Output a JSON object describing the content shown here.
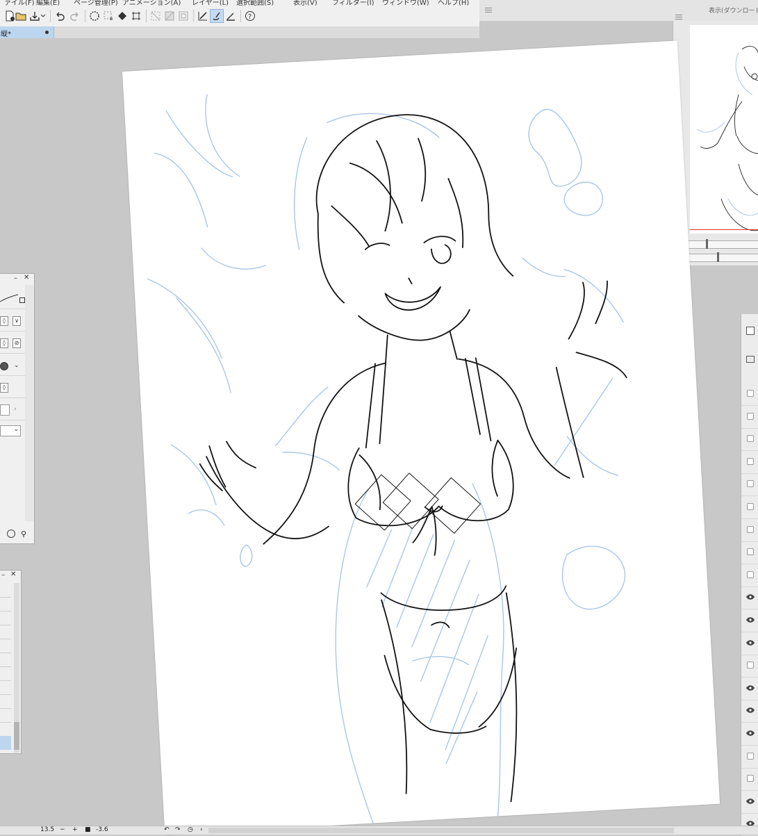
{
  "window": {
    "document_tab": "縦*"
  },
  "menu": {
    "items": [
      "ァイル(F)",
      "編集(E)",
      "ページ管理(P)",
      "アニメーション(A)",
      "レイヤー(L)",
      "選択範囲(S)",
      "表示(V)",
      "フィルター(I)",
      "ウィンドウ(W)",
      "ヘルプ(H)"
    ]
  },
  "toolbar": {
    "icons": [
      "new-icon",
      "open-icon",
      "export-icon",
      "undo-icon",
      "redo-icon",
      "clear-icon",
      "transform-icon",
      "fill-icon",
      "crop-icon",
      "selection-icon",
      "ruler-icon",
      "snap-icon",
      "pen-icon",
      "brush-icon",
      "correction-icon",
      "help-icon"
    ],
    "active_tool": "brush-icon"
  },
  "navigator": {
    "title_fragment": "表示(ダウンロード)"
  },
  "statusbar": {
    "zoom": "13.5",
    "rotation": "-3.6"
  },
  "layers": {
    "visible_rows": [
      false,
      false,
      false,
      false,
      false,
      false,
      false,
      false,
      false,
      true,
      true,
      true,
      false,
      true,
      true,
      true,
      false,
      false,
      true,
      true
    ]
  },
  "colors": {
    "accent": "#bcd6f0",
    "ui_background": "#c8c8c8",
    "sketch_blue": "#a9c6e8",
    "line_art": "#111111"
  }
}
